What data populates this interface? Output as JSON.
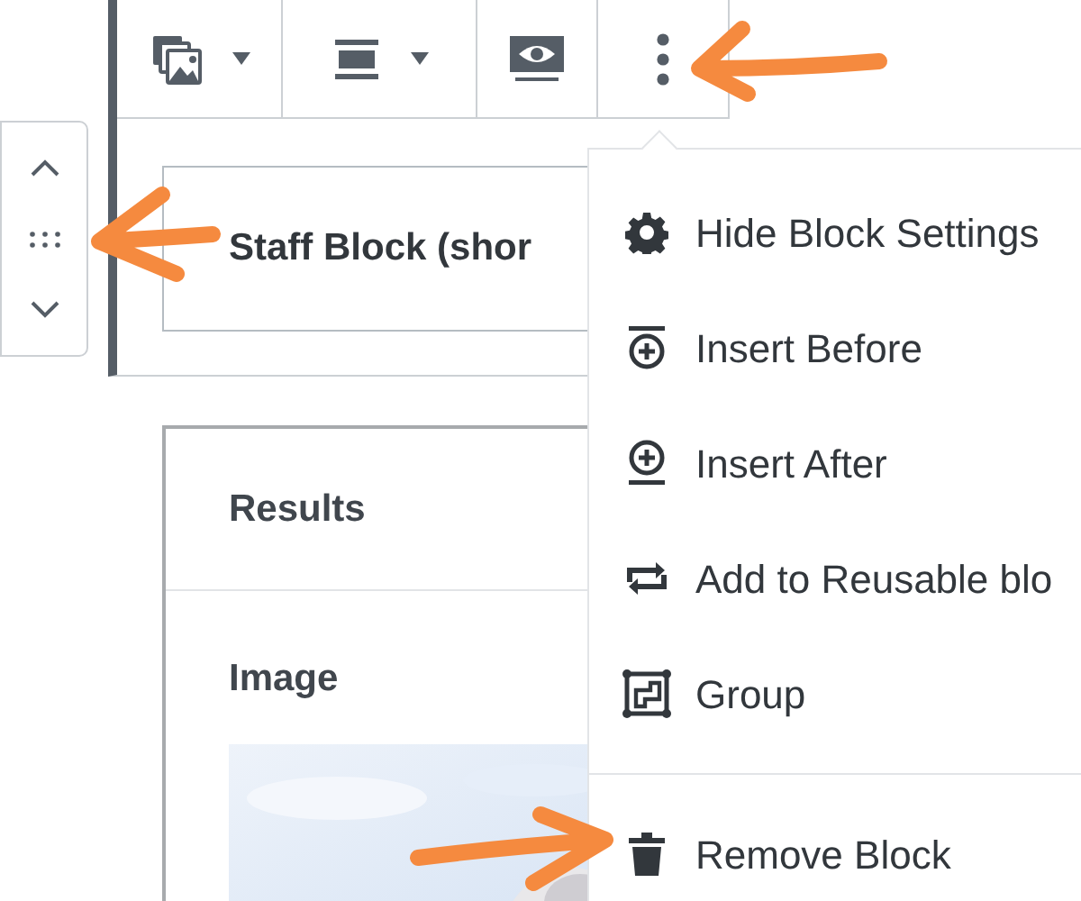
{
  "toolbar": {
    "buttons": [
      {
        "kind": "gallery"
      },
      {
        "kind": "align"
      },
      {
        "kind": "preview"
      },
      {
        "kind": "more"
      }
    ]
  },
  "mover": {
    "buttons": [
      {
        "kind": "up"
      },
      {
        "kind": "drag"
      },
      {
        "kind": "down"
      }
    ]
  },
  "block": {
    "title": "Staff Block (shor"
  },
  "card": {
    "rows": [
      {
        "kind": "heading",
        "label": "Results"
      },
      {
        "label": "Image"
      }
    ]
  },
  "menu": {
    "groups": [
      {
        "items": [
          {
            "kind": "gear",
            "label": "Hide Block Settings"
          },
          {
            "kind": "insert-before",
            "label": "Insert Before"
          },
          {
            "kind": "insert-after",
            "label": "Insert After"
          },
          {
            "kind": "reusable",
            "label": "Add to Reusable blo"
          },
          {
            "kind": "group",
            "label": "Group"
          }
        ]
      },
      {
        "items": [
          {
            "kind": "trash",
            "label": "Remove Block"
          }
        ]
      }
    ]
  },
  "annotations": [
    {
      "kind": "arrow-left-top"
    },
    {
      "kind": "arrow-left-middle"
    },
    {
      "kind": "arrow-right-bottom"
    }
  ]
}
